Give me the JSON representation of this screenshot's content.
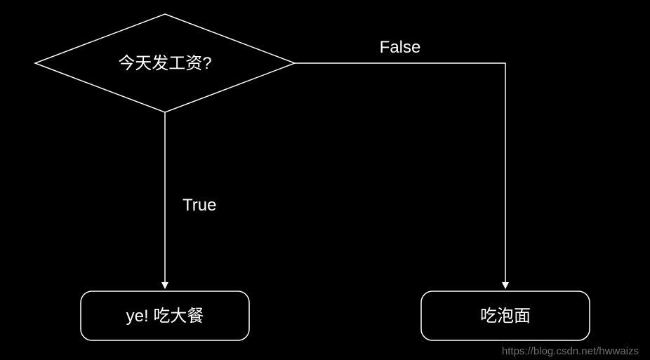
{
  "chart_data": {
    "type": "flowchart",
    "nodes": [
      {
        "id": "decision",
        "shape": "diamond",
        "text": "今天发工资?"
      },
      {
        "id": "true_box",
        "shape": "rounded-rect",
        "text": "ye! 吃大餐"
      },
      {
        "id": "false_box",
        "shape": "rounded-rect",
        "text": "吃泡面"
      }
    ],
    "edges": [
      {
        "from": "decision",
        "to": "true_box",
        "label": "True"
      },
      {
        "from": "decision",
        "to": "false_box",
        "label": "False"
      }
    ]
  },
  "decision_label": "今天发工资?",
  "true_edge_label": "True",
  "false_edge_label": "False",
  "true_box_label": "ye! 吃大餐",
  "false_box_label": "吃泡面",
  "watermark_text": "https://blog.csdn.net/hwwaizs"
}
